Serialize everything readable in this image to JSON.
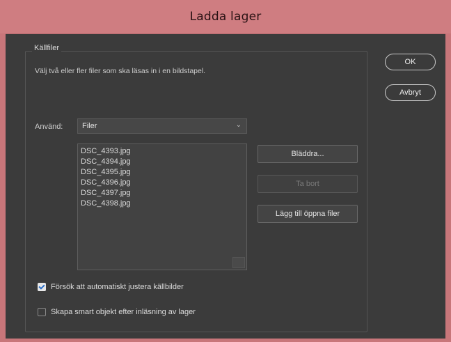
{
  "window": {
    "title": "Ladda lager"
  },
  "source_group": {
    "legend": "Källfiler",
    "description": "Välj två eller fler filer som ska läsas in i en bildstapel.",
    "use_label": "Använd:",
    "use_value": "Filer",
    "files": [
      "DSC_4393.jpg",
      "DSC_4394.jpg",
      "DSC_4395.jpg",
      "DSC_4396.jpg",
      "DSC_4397.jpg",
      "DSC_4398.jpg"
    ]
  },
  "file_buttons": {
    "browse": "Bläddra...",
    "remove": "Ta bort",
    "add_open": "Lägg till öppna filer"
  },
  "dialog_buttons": {
    "ok": "OK",
    "cancel": "Avbryt"
  },
  "options": {
    "auto_align": {
      "label": "Försök att automatiskt justera källbilder",
      "checked": true
    },
    "smart_object": {
      "label": "Skapa smart objekt efter inläsning av lager",
      "checked": false
    }
  }
}
